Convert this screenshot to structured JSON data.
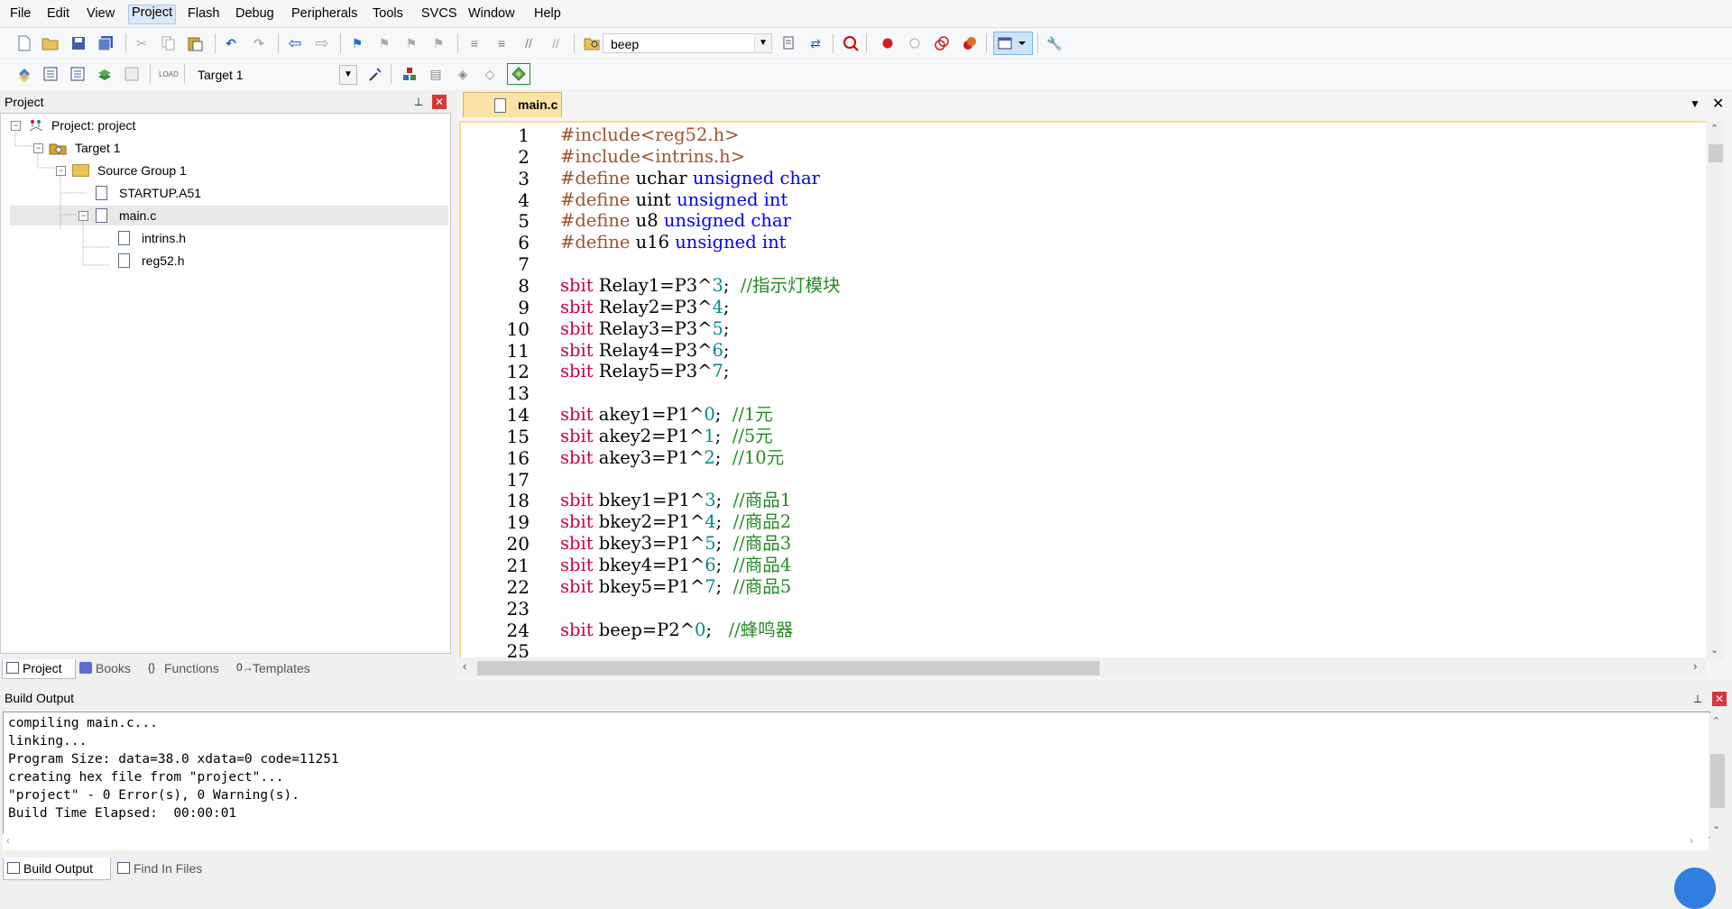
{
  "menu": {
    "items": [
      "File",
      "Edit",
      "View",
      "Project",
      "Flash",
      "Debug",
      "Peripherals",
      "Tools",
      "SVCS",
      "Window",
      "Help"
    ],
    "active": "Project"
  },
  "toolbar1": {
    "find_combo_value": "beep"
  },
  "toolbar2": {
    "target_combo_value": "Target 1"
  },
  "project_panel": {
    "title": "Project",
    "tree": [
      {
        "label": "Project: project",
        "level": 0,
        "kind": "project",
        "expanded": true
      },
      {
        "label": "Target 1",
        "level": 1,
        "kind": "target",
        "expanded": true
      },
      {
        "label": "Source Group 1",
        "level": 2,
        "kind": "folder",
        "expanded": true
      },
      {
        "label": "STARTUP.A51",
        "level": 3,
        "kind": "file"
      },
      {
        "label": "main.c",
        "level": 3,
        "kind": "file",
        "expanded": true,
        "selected": true
      },
      {
        "label": "intrins.h",
        "level": 4,
        "kind": "file"
      },
      {
        "label": "reg52.h",
        "level": 4,
        "kind": "file"
      }
    ],
    "tabs": [
      "Project",
      "Books",
      "Functions",
      "Templates"
    ],
    "active_tab": "Project"
  },
  "editor": {
    "tab_title": "main.c",
    "lines": [
      {
        "n": "1",
        "parts": [
          [
            "#include<reg52.h>",
            "pp"
          ]
        ]
      },
      {
        "n": "2",
        "parts": [
          [
            "#include<intrins.h>",
            "pp"
          ]
        ]
      },
      {
        "n": "3",
        "parts": [
          [
            "#define",
            "pp"
          ],
          [
            " uchar ",
            "plain"
          ],
          [
            "unsigned char",
            "kw"
          ]
        ]
      },
      {
        "n": "4",
        "parts": [
          [
            "#define",
            "pp"
          ],
          [
            " uint ",
            "plain"
          ],
          [
            "unsigned int",
            "kw"
          ]
        ]
      },
      {
        "n": "5",
        "parts": [
          [
            "#define",
            "pp"
          ],
          [
            " u8 ",
            "plain"
          ],
          [
            "unsigned char",
            "kw"
          ]
        ]
      },
      {
        "n": "6",
        "parts": [
          [
            "#define",
            "pp"
          ],
          [
            " u16 ",
            "plain"
          ],
          [
            "unsigned int",
            "kw"
          ]
        ]
      },
      {
        "n": "7",
        "parts": []
      },
      {
        "n": "8",
        "parts": [
          [
            "sbit",
            "sbit"
          ],
          [
            " Relay1=P3^",
            "plain"
          ],
          [
            "3",
            "num"
          ],
          [
            ";  ",
            "plain"
          ],
          [
            "//指示灯模块",
            "cmt"
          ]
        ]
      },
      {
        "n": "9",
        "parts": [
          [
            "sbit",
            "sbit"
          ],
          [
            " Relay2=P3^",
            "plain"
          ],
          [
            "4",
            "num"
          ],
          [
            ";",
            "plain"
          ]
        ]
      },
      {
        "n": "10",
        "parts": [
          [
            "sbit",
            "sbit"
          ],
          [
            " Relay3=P3^",
            "plain"
          ],
          [
            "5",
            "num"
          ],
          [
            ";",
            "plain"
          ]
        ]
      },
      {
        "n": "11",
        "parts": [
          [
            "sbit",
            "sbit"
          ],
          [
            " Relay4=P3^",
            "plain"
          ],
          [
            "6",
            "num"
          ],
          [
            ";",
            "plain"
          ]
        ]
      },
      {
        "n": "12",
        "parts": [
          [
            "sbit",
            "sbit"
          ],
          [
            " Relay5=P3^",
            "plain"
          ],
          [
            "7",
            "num"
          ],
          [
            ";",
            "plain"
          ]
        ]
      },
      {
        "n": "13",
        "parts": []
      },
      {
        "n": "14",
        "parts": [
          [
            "sbit",
            "sbit"
          ],
          [
            " akey1=P1^",
            "plain"
          ],
          [
            "0",
            "num"
          ],
          [
            ";  ",
            "plain"
          ],
          [
            "//1元",
            "cmt"
          ]
        ]
      },
      {
        "n": "15",
        "parts": [
          [
            "sbit",
            "sbit"
          ],
          [
            " akey2=P1^",
            "plain"
          ],
          [
            "1",
            "num"
          ],
          [
            ";  ",
            "plain"
          ],
          [
            "//5元",
            "cmt"
          ]
        ]
      },
      {
        "n": "16",
        "parts": [
          [
            "sbit",
            "sbit"
          ],
          [
            " akey3=P1^",
            "plain"
          ],
          [
            "2",
            "num"
          ],
          [
            ";  ",
            "plain"
          ],
          [
            "//10元",
            "cmt"
          ]
        ]
      },
      {
        "n": "17",
        "parts": []
      },
      {
        "n": "18",
        "parts": [
          [
            "sbit",
            "sbit"
          ],
          [
            " bkey1=P1^",
            "plain"
          ],
          [
            "3",
            "num"
          ],
          [
            ";  ",
            "plain"
          ],
          [
            "//商品1",
            "cmt"
          ]
        ]
      },
      {
        "n": "19",
        "parts": [
          [
            "sbit",
            "sbit"
          ],
          [
            " bkey2=P1^",
            "plain"
          ],
          [
            "4",
            "num"
          ],
          [
            ";  ",
            "plain"
          ],
          [
            "//商品2",
            "cmt"
          ]
        ]
      },
      {
        "n": "20",
        "parts": [
          [
            "sbit",
            "sbit"
          ],
          [
            " bkey3=P1^",
            "plain"
          ],
          [
            "5",
            "num"
          ],
          [
            ";  ",
            "plain"
          ],
          [
            "//商品3",
            "cmt"
          ]
        ]
      },
      {
        "n": "21",
        "parts": [
          [
            "sbit",
            "sbit"
          ],
          [
            " bkey4=P1^",
            "plain"
          ],
          [
            "6",
            "num"
          ],
          [
            ";  ",
            "plain"
          ],
          [
            "//商品4",
            "cmt"
          ]
        ]
      },
      {
        "n": "22",
        "parts": [
          [
            "sbit",
            "sbit"
          ],
          [
            " bkey5=P1^",
            "plain"
          ],
          [
            "7",
            "num"
          ],
          [
            ";  ",
            "plain"
          ],
          [
            "//商品5",
            "cmt"
          ]
        ]
      },
      {
        "n": "23",
        "parts": []
      },
      {
        "n": "24",
        "parts": [
          [
            "sbit",
            "sbit"
          ],
          [
            " beep=P2^",
            "plain"
          ],
          [
            "0",
            "num"
          ],
          [
            ";   ",
            "plain"
          ],
          [
            "//蜂鸣器",
            "cmt"
          ]
        ]
      },
      {
        "n": "25",
        "parts": []
      }
    ]
  },
  "build_output": {
    "title": "Build Output",
    "lines": [
      "compiling main.c...",
      "linking...",
      "Program Size: data=38.0 xdata=0 code=11251",
      "creating hex file from \"project\"...",
      "\"project\" - 0 Error(s), 0 Warning(s).",
      "Build Time Elapsed:  00:00:01"
    ],
    "tabs": [
      "Build Output",
      "Find In Files"
    ],
    "active_tab": "Build Output"
  },
  "colors": {
    "preprocessor": "#a0522d",
    "keyword": "#0000ff",
    "sbit": "#c8004c",
    "number": "#008b8b",
    "comment": "#228b22",
    "plain": "#000000",
    "tab_active_bg": "#fbe3a6"
  }
}
